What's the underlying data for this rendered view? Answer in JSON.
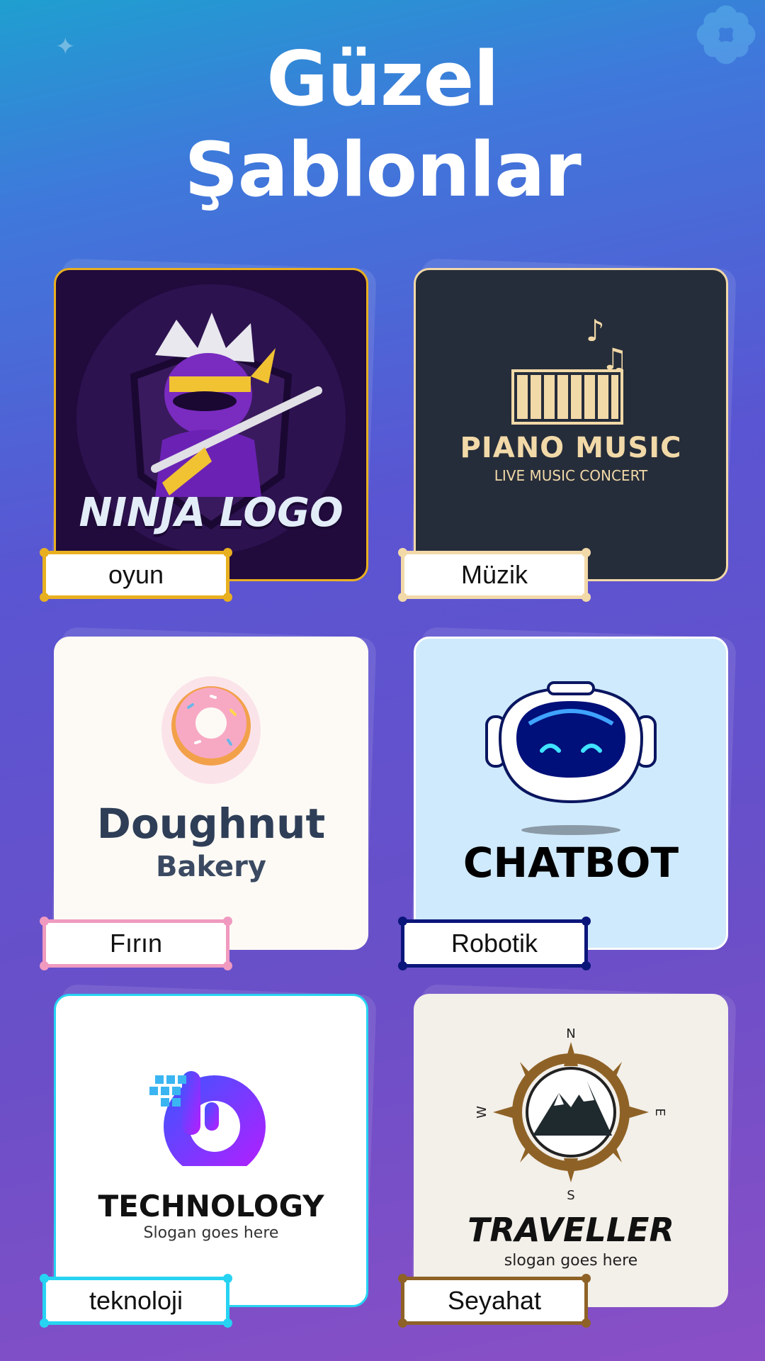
{
  "header": {
    "line1": "Güzel",
    "line2": "Şablonlar"
  },
  "cards": [
    {
      "category": "oyun",
      "logo_text": "NINJA LOGO",
      "accent": "#e8b020",
      "bg": "#210a3c"
    },
    {
      "category": "Müzik",
      "logo_title": "PIANO MUSIC",
      "logo_sub": "LIVE MUSIC CONCERT",
      "accent": "#f2d9a8",
      "bg": "#262d3a"
    },
    {
      "category": "Fırın",
      "logo_title": "Doughnut",
      "logo_sub": "Bakery",
      "accent": "#f09ac0",
      "bg": "#fdfaf5"
    },
    {
      "category": "Robotik",
      "logo_title": "CHATBOT",
      "accent": "#0a167a",
      "bg": "#cfeafc"
    },
    {
      "category": "teknoloji",
      "logo_title": "TECHNOLOGY",
      "logo_sub": "Slogan goes here",
      "accent": "#27d3f2",
      "bg": "#ffffff"
    },
    {
      "category": "Seyahat",
      "logo_title": "TRAVELLER",
      "logo_sub": "slogan goes here",
      "compass": [
        "N",
        "S",
        "E",
        "W"
      ],
      "accent": "#8e6226",
      "bg": "#f3efe9"
    }
  ]
}
